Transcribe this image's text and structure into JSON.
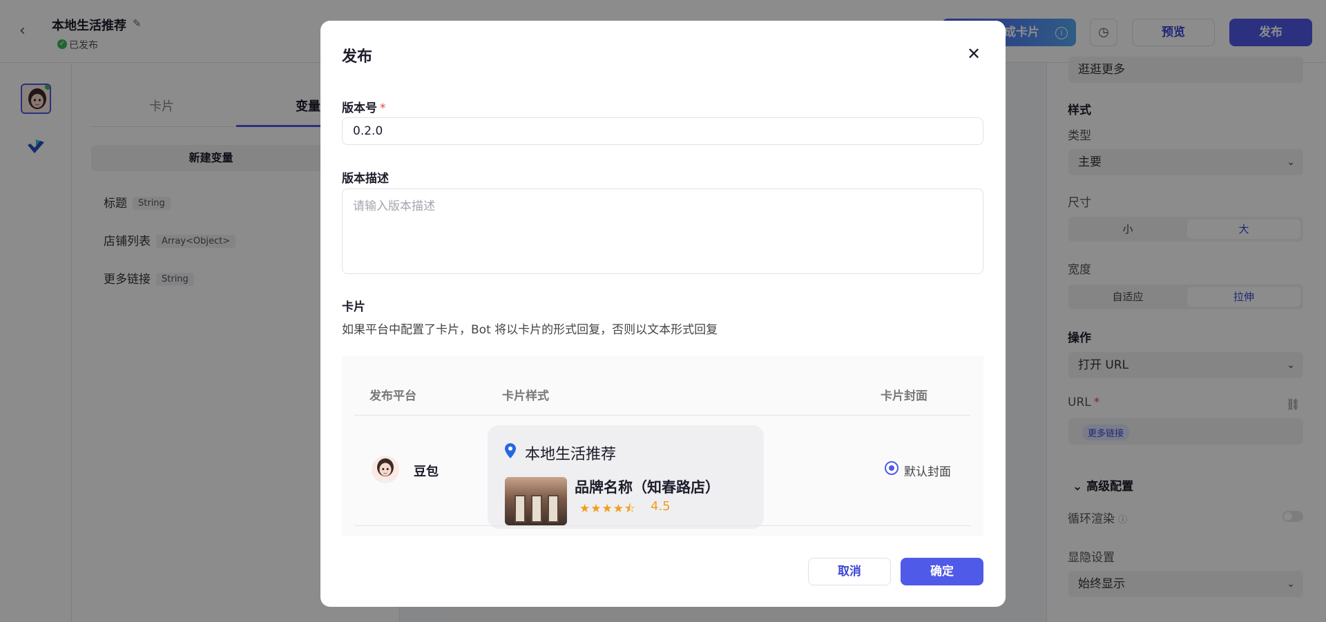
{
  "header": {
    "title": "本地生活推荐",
    "status": "已发布",
    "generate_button": "成卡片",
    "preview_button": "预览",
    "publish_button": "发布"
  },
  "variables_panel": {
    "tabs": [
      "卡片",
      "变量"
    ],
    "new_variable_button": "新建变量",
    "variables": [
      {
        "name": "标题",
        "type": "String"
      },
      {
        "name": "店铺列表",
        "type": "Array<Object>"
      },
      {
        "name": "更多链接",
        "type": "String"
      }
    ]
  },
  "right_panel": {
    "top_value": "逛逛更多",
    "style_section": "样式",
    "type_label": "类型",
    "type_value": "主要",
    "size_label": "尺寸",
    "size_options": [
      "小",
      "大"
    ],
    "size_selected": "大",
    "width_label": "宽度",
    "width_options": [
      "自适应",
      "拉伸"
    ],
    "width_selected": "拉伸",
    "action_section": "操作",
    "action_value": "打开 URL",
    "url_label": "URL",
    "url_tag": "更多链接",
    "advanced_section": "高级配置",
    "loop_render_label": "循环渲染",
    "visibility_label": "显隐设置",
    "visibility_value": "始终显示"
  },
  "modal": {
    "title": "发布",
    "version_label": "版本号",
    "version_value": "0.2.0",
    "description_label": "版本描述",
    "description_placeholder": "请输入版本描述",
    "card_section_label": "卡片",
    "card_hint": "如果平台中配置了卡片，Bot 将以卡片的形式回复，否则以文本形式回复",
    "table": {
      "headers": [
        "发布平台",
        "卡片样式",
        "卡片封面"
      ],
      "rows": [
        {
          "platform": "豆包",
          "card_title": "本地生活推荐",
          "shop_name": "品牌名称（知春路店）",
          "stars": "★★★★⯪",
          "rating": "4.5",
          "cover": "默认封面"
        }
      ]
    },
    "cancel_button": "取消",
    "confirm_button": "确定"
  },
  "colors": {
    "accent": "#4f5ae8",
    "rating": "#f29d1b",
    "success": "#3cba5c",
    "required": "#e5483f"
  }
}
